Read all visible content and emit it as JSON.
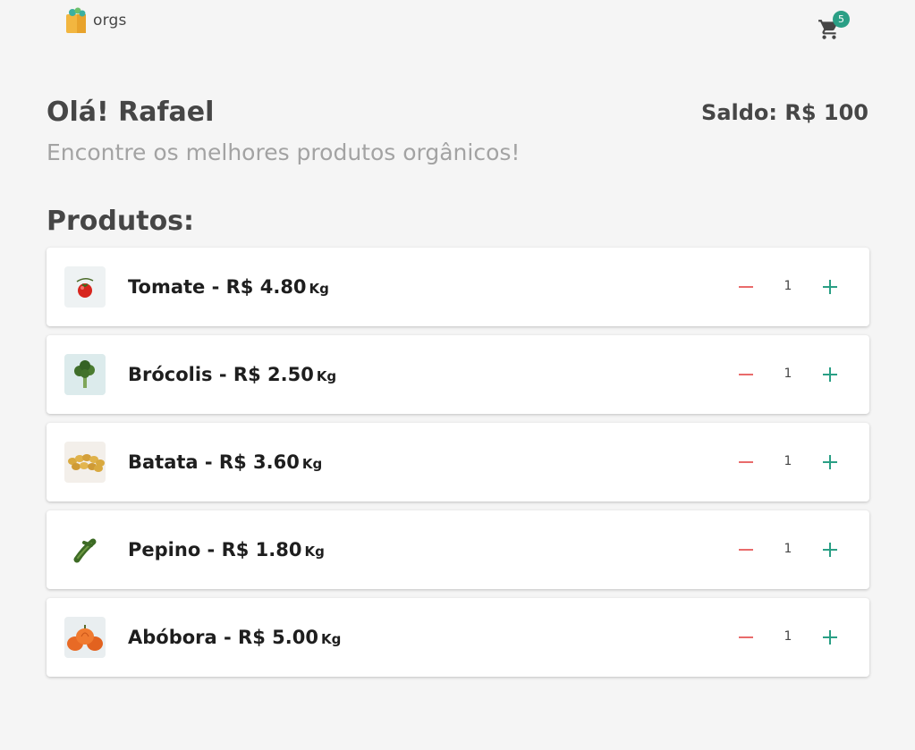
{
  "header": {
    "logo_text": "orgs",
    "cart_count": "5"
  },
  "hero": {
    "greeting": "Olá! Rafael",
    "balance": "Saldo: R$ 100",
    "subtitle": "Encontre os melhores produtos orgânicos!"
  },
  "products_section": {
    "title": "Produtos:"
  },
  "products": [
    {
      "name": "Tomate - R$ 4.80",
      "unit": "Kg",
      "quantity": "1",
      "icon": "tomato-icon"
    },
    {
      "name": "Brócolis - R$ 2.50",
      "unit": "Kg",
      "quantity": "1",
      "icon": "broccoli-icon"
    },
    {
      "name": "Batata - R$ 3.60",
      "unit": "Kg",
      "quantity": "1",
      "icon": "potato-icon"
    },
    {
      "name": "Pepino - R$ 1.80",
      "unit": "Kg",
      "quantity": "1",
      "icon": "cucumber-icon"
    },
    {
      "name": "Abóbora - R$ 5.00",
      "unit": "Kg",
      "quantity": "1",
      "icon": "pumpkin-icon"
    }
  ],
  "colors": {
    "accent": "#2a9f85",
    "decrement": "#e96b6b",
    "text": "#464646",
    "muted": "#a3a3a3",
    "background": "#f5f5f5"
  }
}
